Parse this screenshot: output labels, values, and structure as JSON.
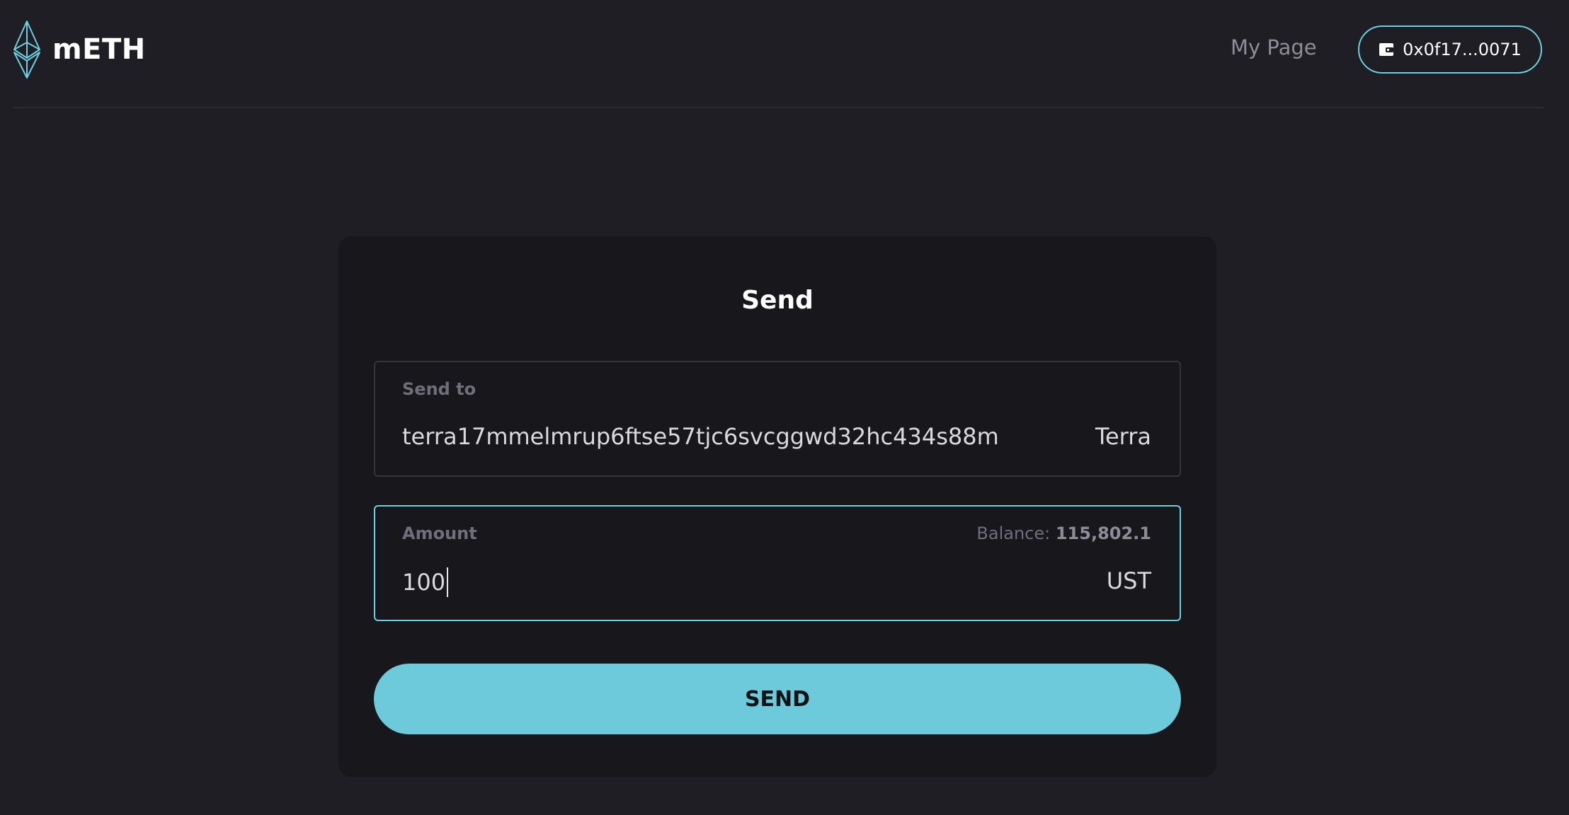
{
  "header": {
    "brand": "mETH",
    "logo_icon": "ethereum-diamond-icon",
    "nav_mypage": "My Page",
    "wallet_address": "0x0f17...0071",
    "wallet_icon": "wallet-icon"
  },
  "send_card": {
    "title": "Send",
    "recipient": {
      "label": "Send to",
      "value": "terra17mmelmrup6ftse57tjc6svcggwd32hc434s88m",
      "network": "Terra"
    },
    "amount": {
      "label": "Amount",
      "balance_label": "Balance:",
      "balance_value": "115,802.1",
      "value": "100",
      "unit": "UST"
    },
    "submit_label": "SEND"
  },
  "colors": {
    "background": "#1f1e24",
    "card": "#18171c",
    "accent": "#6ccadb"
  }
}
